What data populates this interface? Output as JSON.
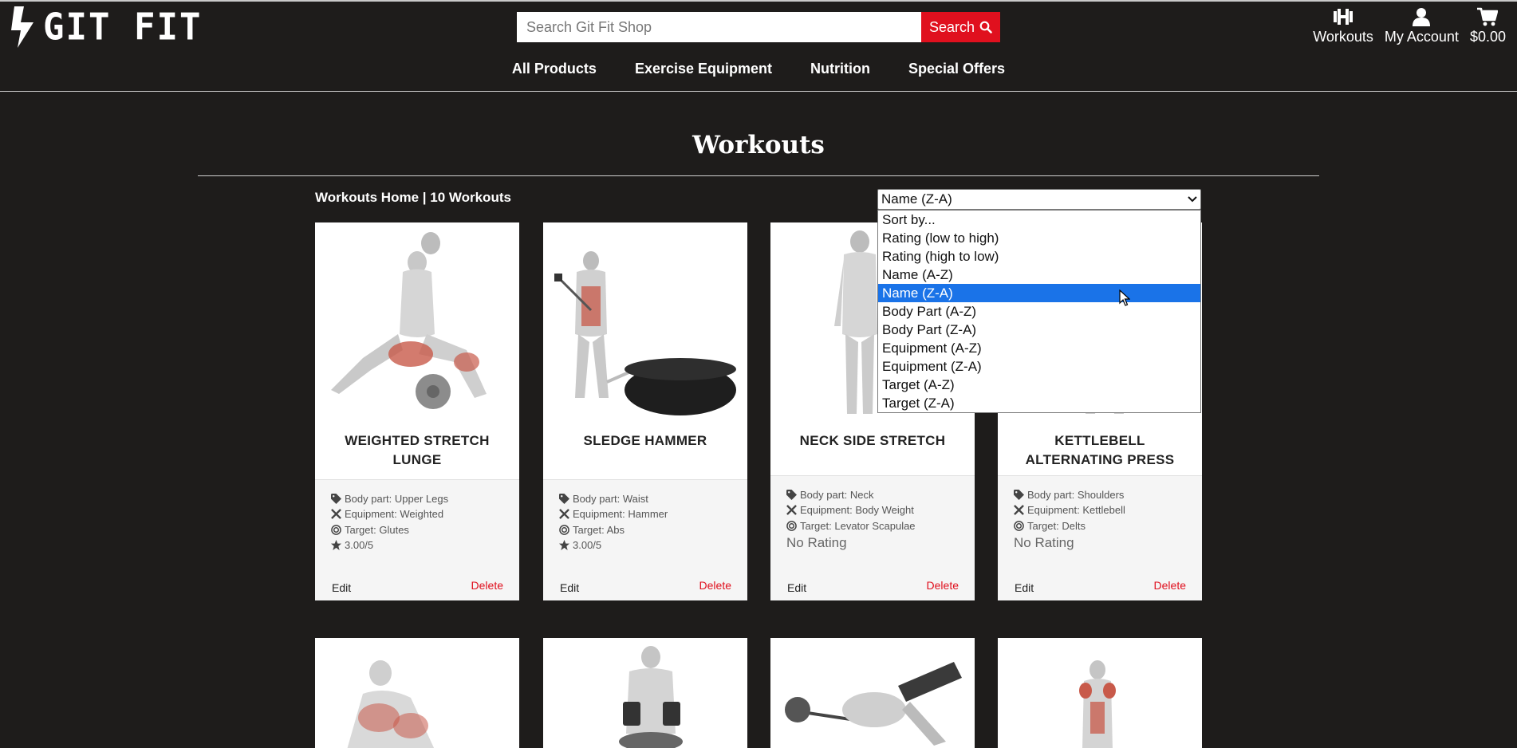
{
  "header": {
    "logo_text": "GIT FIT",
    "search": {
      "placeholder": "Search Git Fit Shop",
      "button_label": "Search"
    },
    "icons": [
      {
        "label": "Workouts",
        "icon": "dumbbell-icon"
      },
      {
        "label": "My Account",
        "icon": "user-icon"
      },
      {
        "label": "$0.00",
        "icon": "cart-icon"
      }
    ],
    "nav": [
      "All Products",
      "Exercise Equipment",
      "Nutrition",
      "Special Offers"
    ]
  },
  "page": {
    "title": "Workouts",
    "breadcrumb": "Workouts Home | 10 Workouts"
  },
  "sort": {
    "selected": "Name (Z-A)",
    "options": [
      "Sort by...",
      "Rating (low to high)",
      "Rating (high to low)",
      "Name (A-Z)",
      "Name (Z-A)",
      "Body Part (A-Z)",
      "Body Part (Z-A)",
      "Equipment (A-Z)",
      "Equipment (Z-A)",
      "Target (A-Z)",
      "Target (Z-A)"
    ],
    "highlighted_index": 4
  },
  "workouts": [
    {
      "name": "WEIGHTED STRETCH LUNGE",
      "body_part": "Body part: Upper Legs",
      "equipment": "Equipment: Weighted",
      "target": "Target: Glutes",
      "rating": "3.00/5",
      "edit": "Edit",
      "delete": "Delete"
    },
    {
      "name": "SLEDGE HAMMER",
      "body_part": "Body part: Waist",
      "equipment": "Equipment: Hammer",
      "target": "Target: Abs",
      "rating": "3.00/5",
      "edit": "Edit",
      "delete": "Delete"
    },
    {
      "name": "NECK SIDE STRETCH",
      "body_part": "Body part: Neck",
      "equipment": "Equipment: Body Weight",
      "target": "Target: Levator Scapulae",
      "rating": "No Rating",
      "edit": "Edit",
      "delete": "Delete"
    },
    {
      "name": "KETTLEBELL ALTERNATING PRESS",
      "body_part": "Body part: Shoulders",
      "equipment": "Equipment: Kettlebell",
      "target": "Target: Delts",
      "rating": "No Rating",
      "edit": "Edit",
      "delete": "Delete"
    }
  ],
  "colors": {
    "background": "#1e1c1b",
    "accent": "#e0101e",
    "highlight": "#1a73e8"
  }
}
